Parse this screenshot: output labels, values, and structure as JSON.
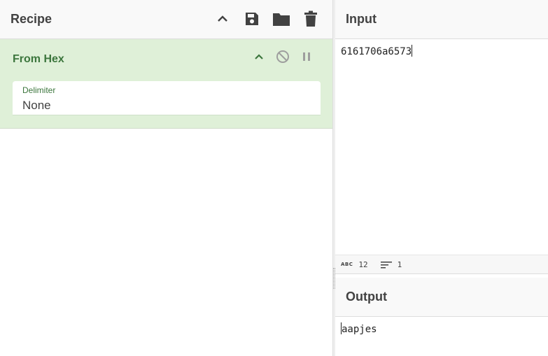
{
  "recipe": {
    "title": "Recipe",
    "operation": {
      "name": "From Hex",
      "argument": {
        "label": "Delimiter",
        "value": "None"
      }
    }
  },
  "input": {
    "title": "Input",
    "text": "6161706a6573",
    "status": {
      "chars": "12",
      "lines": "1"
    }
  },
  "output": {
    "title": "Output",
    "text": "aapjes"
  },
  "icons": {
    "collapse": "chevron-up-icon",
    "save": "save-icon",
    "load": "folder-icon",
    "clear": "trash-icon",
    "disable": "disable-icon",
    "breakpoint": "pause-icon"
  },
  "colors": {
    "operation_bg": "#dff0d8",
    "operation_text": "#3c763d",
    "header_bg": "#f9f9f9"
  }
}
